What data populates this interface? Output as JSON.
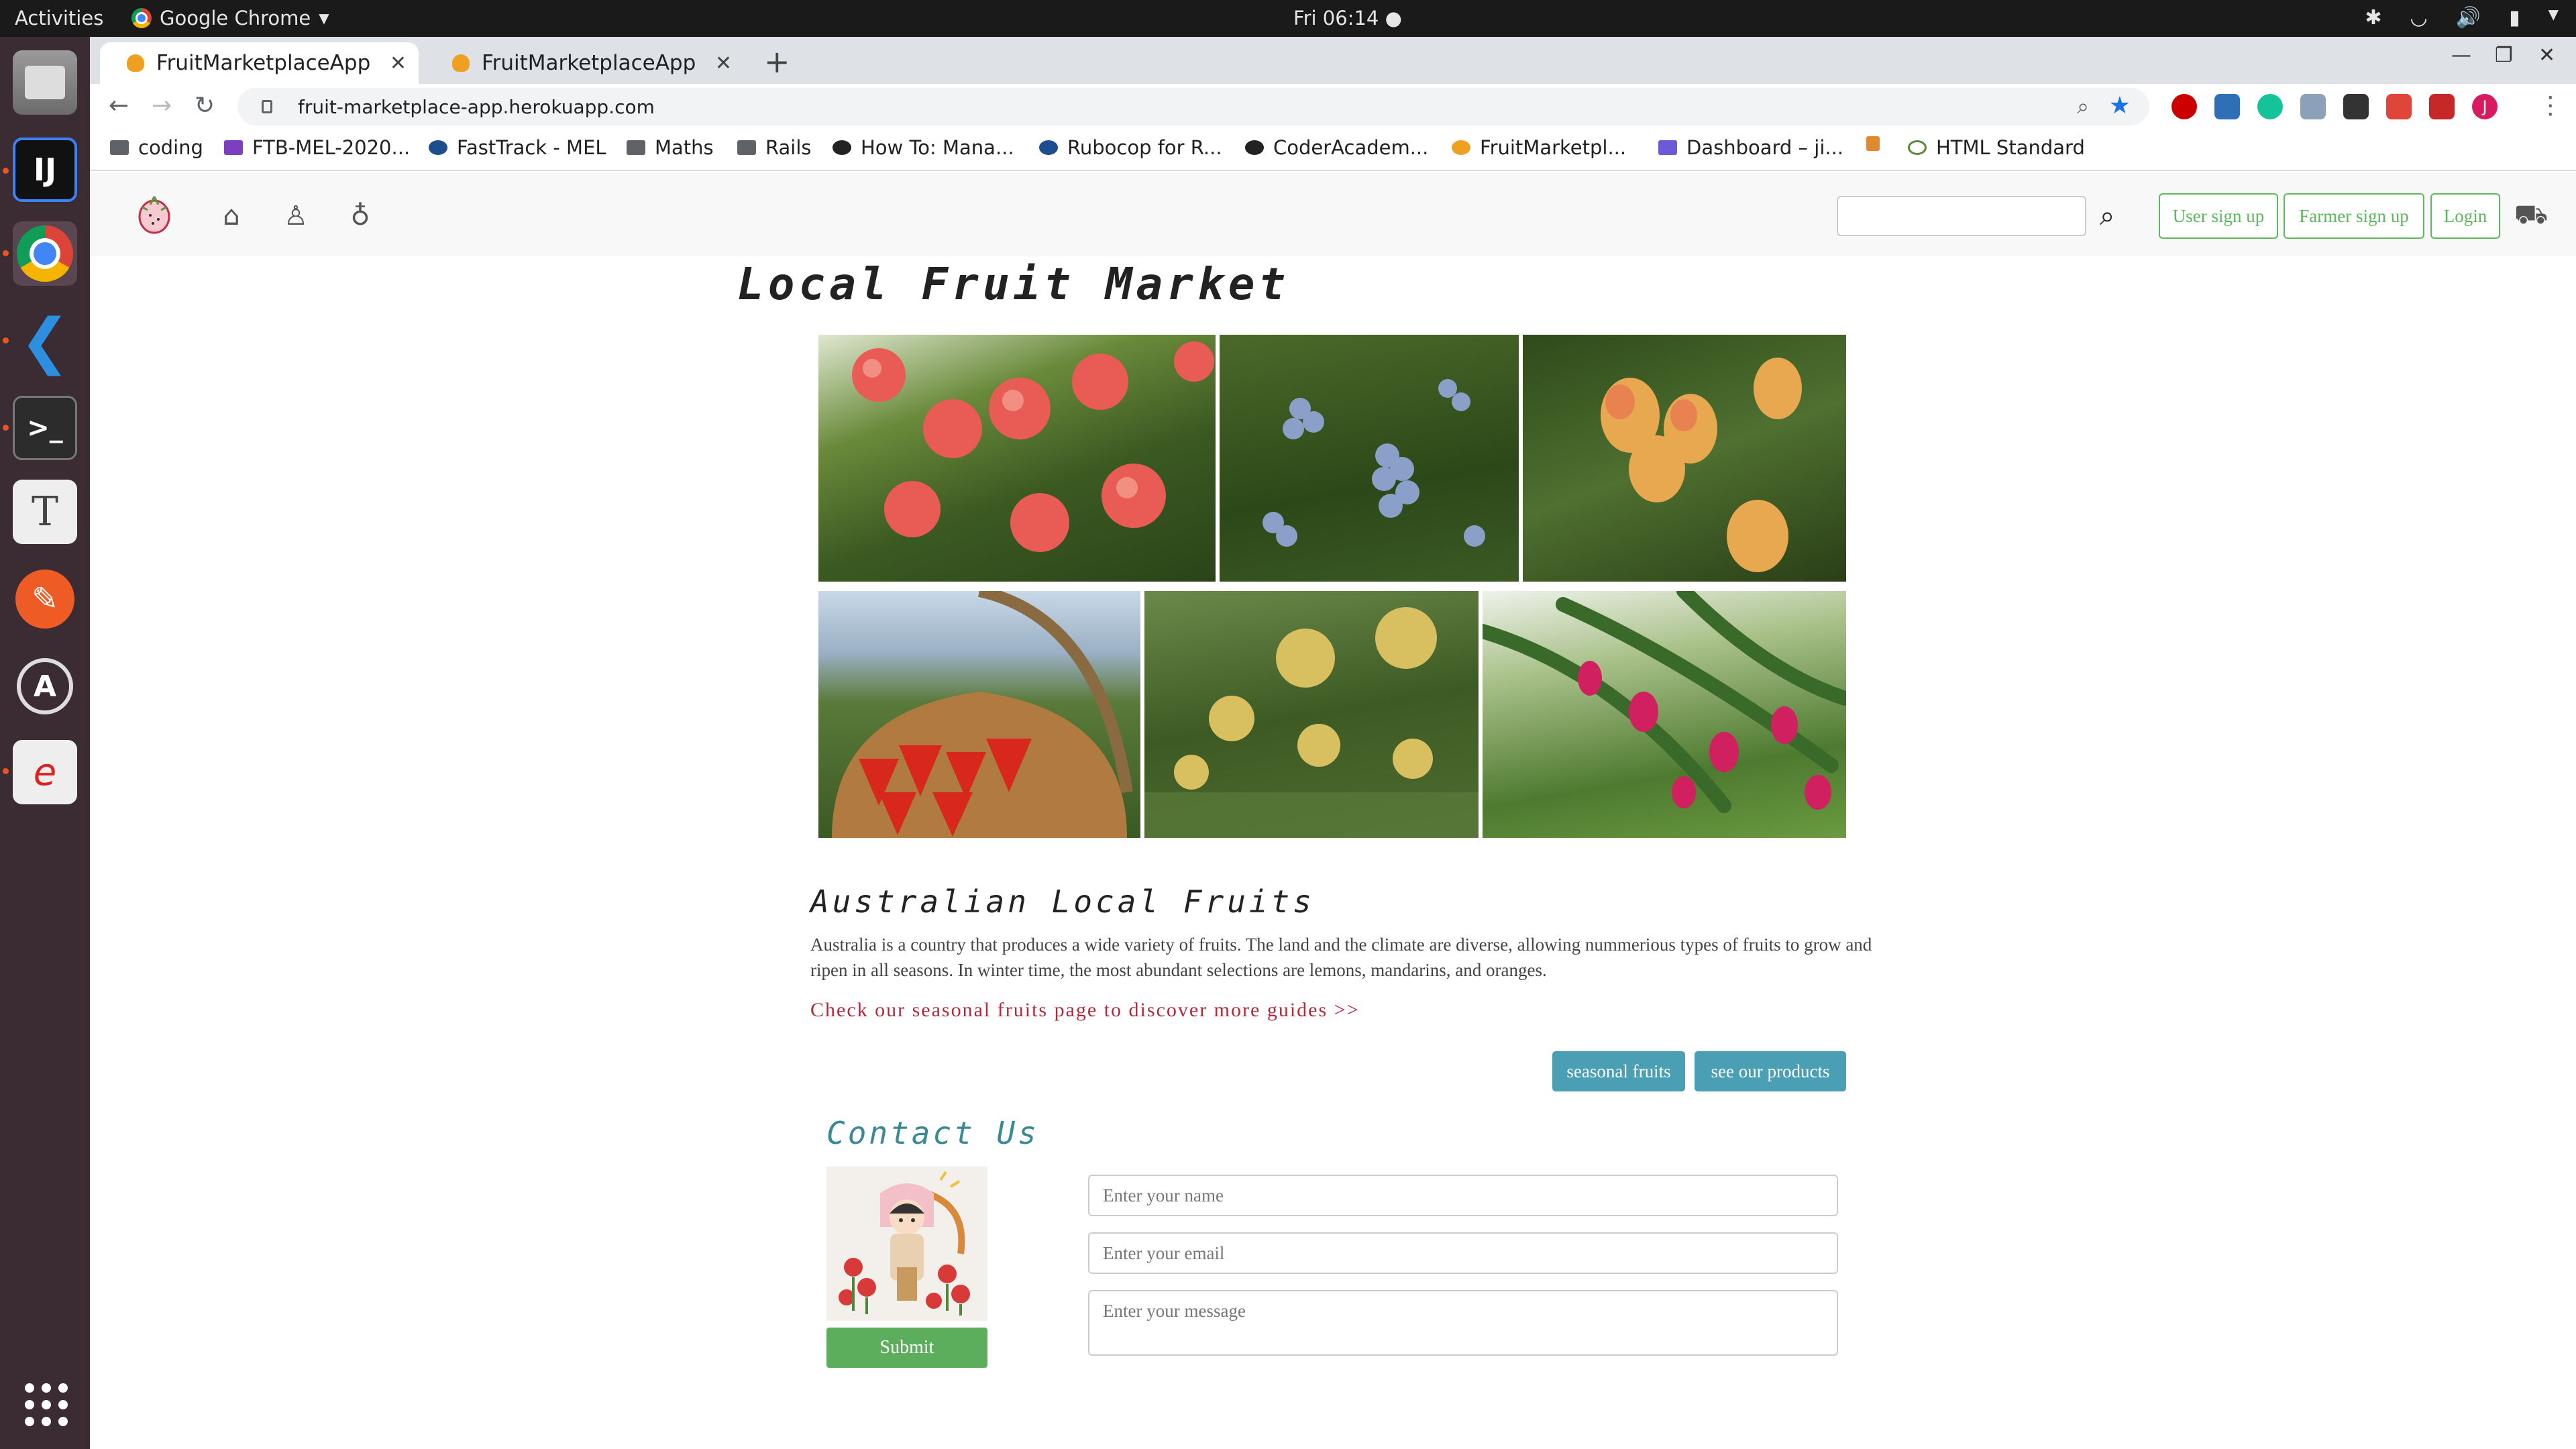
{
  "system": {
    "activities": "Activities",
    "app_name": "Google Chrome",
    "clock": "Fri 06:14"
  },
  "browser": {
    "tabs": [
      {
        "title": "FruitMarketplaceApp",
        "active": true
      },
      {
        "title": "FruitMarketplaceApp",
        "active": false
      }
    ],
    "url": "fruit-marketplace-app.herokuapp.com",
    "bookmarks": [
      "coding",
      "FTB-MEL-2020...",
      "FastTrack - MEL",
      "Maths",
      "Rails",
      "How To: Mana...",
      "Rubocop for R...",
      "CoderAcadem...",
      "FruitMarketpl...",
      "Dashboard – ji...",
      "HTML Standard"
    ],
    "profile_initial": "J"
  },
  "nav": {
    "user_signup": "User sign up",
    "farmer_signup": "Farmer sign up",
    "login": "Login",
    "search_value": ""
  },
  "hero": {
    "title": "Local Fruit Market"
  },
  "section": {
    "heading": "Australian Local Fruits",
    "body": "Australia is a country that produces a wide variety of fruits. The land and the climate are diverse, allowing nummerious types of fruits to grow and ripen in all seasons. In winter time, the most abundant selections are lemons, mandarins, and oranges.",
    "guide_link": "Check our seasonal fruits page to discover more guides >>",
    "btn_seasonal": "seasonal fruits",
    "btn_products": "see our products"
  },
  "contact": {
    "heading": "Contact Us",
    "name_placeholder": "Enter your name",
    "email_placeholder": "Enter your email",
    "message_placeholder": "Enter your message",
    "submit": "Submit"
  },
  "colors": {
    "green": "#5cb85c",
    "teal": "#4a9fb5",
    "link_red": "#b5283c"
  }
}
